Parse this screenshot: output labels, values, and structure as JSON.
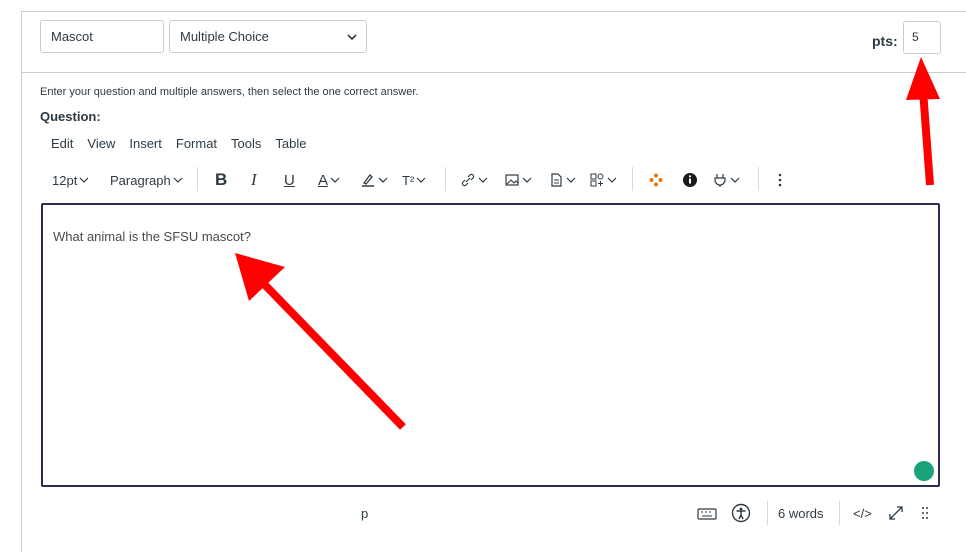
{
  "question": {
    "title_value": "Mascot",
    "type_selected": "Multiple Choice",
    "pts_label": "pts:",
    "pts_value": "5",
    "instructions": "Enter your question and multiple answers, then select the one correct answer.",
    "label": "Question:"
  },
  "menubar": [
    "Edit",
    "View",
    "Insert",
    "Format",
    "Tools",
    "Table"
  ],
  "toolbar": {
    "font_size": "12pt",
    "block_format": "Paragraph",
    "bold": "B",
    "italic": "I",
    "underline": "U",
    "font_color": "A",
    "superscript": "T²"
  },
  "editor": {
    "content": "What animal is the SFSU mascot?"
  },
  "statusbar": {
    "element_path": "p",
    "word_count": "6 words",
    "html_toggle": "</>"
  },
  "colors": {
    "accent_green": "#1aa37a",
    "arrow_red": "#ff0000",
    "editor_border": "#2b2b55"
  }
}
